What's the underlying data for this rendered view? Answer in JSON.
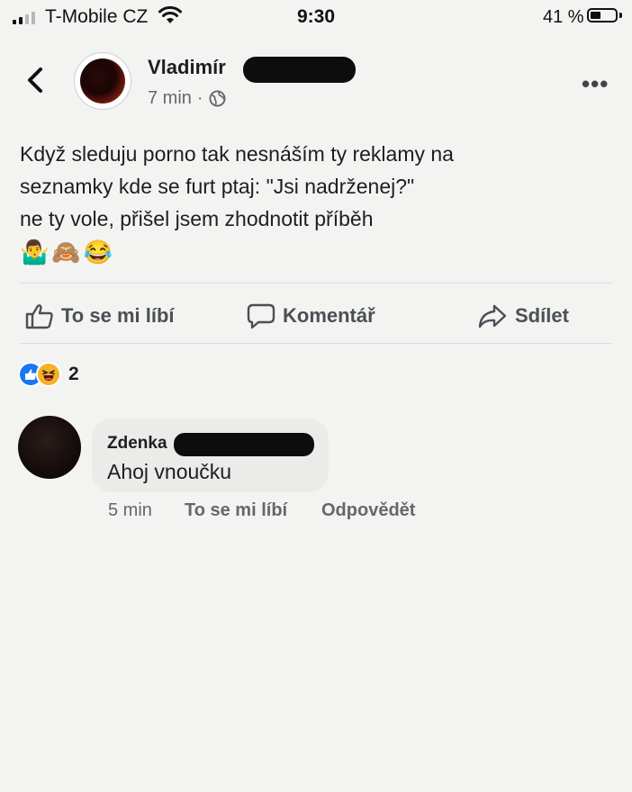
{
  "status_bar": {
    "carrier": "T-Mobile CZ",
    "time": "9:30",
    "battery_percent": "41 %",
    "battery_level": 0.41
  },
  "post": {
    "author_name": "Vladimír",
    "time": "7 min",
    "separator": "·",
    "privacy_icon": "globe-icon",
    "text_lines": [
      "Když sleduju porno tak nesnáším ty reklamy na",
      "seznamky kde se furt ptaj: \"Jsi nadrženej?\"",
      "ne ty vole, přišel jsem zhodnotit příběh"
    ],
    "emojis": [
      "🤷‍♂️",
      "🙈",
      "😂"
    ]
  },
  "actions": {
    "like_label": "To se mi líbí",
    "comment_label": "Komentář",
    "share_label": "Sdílet"
  },
  "reactions": {
    "icons": [
      "like-icon",
      "haha-icon"
    ],
    "count": "2"
  },
  "comment": {
    "author_name": "Zdenka",
    "text": "Ahoj vnoučku",
    "time": "5 min",
    "like_label": "To se mi líbí",
    "reply_label": "Odpovědět"
  },
  "colors": {
    "background": "#f3f4f1",
    "like_blue": "#1877f2",
    "haha_yellow": "#f7b125",
    "meta_gray": "#65676b",
    "bubble": "#ebece9"
  }
}
